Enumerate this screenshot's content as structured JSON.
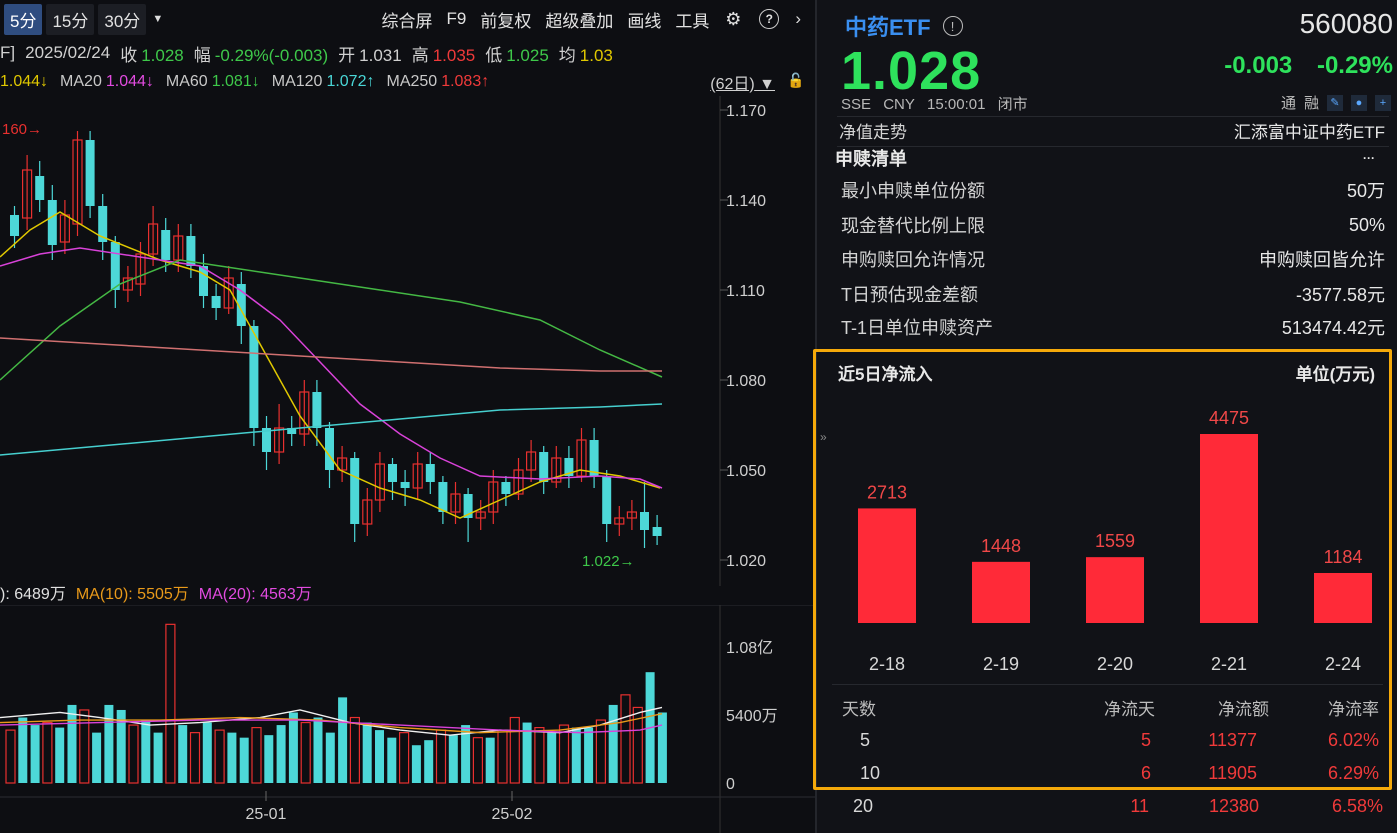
{
  "toolbar": {
    "periods": [
      "5分",
      "15分",
      "30分"
    ],
    "dropdown": "▼",
    "tools": [
      "综合屏",
      "F9",
      "前复权",
      "超级叠加",
      "画线",
      "工具"
    ],
    "settings_icon": "gear-icon",
    "help": "?",
    "more": "›"
  },
  "info": {
    "prefix": "F]",
    "date": "2025/02/24",
    "close_label": "收",
    "close": "1.028",
    "amp_label": "幅",
    "amp": "-0.29%(-0.003)",
    "open_label": "开",
    "open": "1.031",
    "high_label": "高",
    "high": "1.035",
    "low_label": "低",
    "low": "1.025",
    "avg_label": "均",
    "avg": "1.03"
  },
  "ma": {
    "ma10": "1.044↓",
    "ma20_label": "MA20",
    "ma20": "1.044↓",
    "ma60_label": "MA60",
    "ma60": "1.081↓",
    "ma120_label": "MA120",
    "ma120": "1.072↑",
    "ma250_label": "MA250",
    "ma250": "1.083↑",
    "period": "(62日)"
  },
  "price_axis": [
    "1.170",
    "1.140",
    "1.110",
    "1.080",
    "1.050",
    "1.020"
  ],
  "annotations": {
    "high_mark": "160",
    "low_mark": "1.022"
  },
  "volume": {
    "vol": "): 6489万",
    "ma10": "MA(10): 5505万",
    "ma20": "MA(20): 4563万",
    "axis": [
      "1.08亿",
      "5400万",
      "0"
    ]
  },
  "x_axis": [
    "25-01",
    "25-02"
  ],
  "etf": {
    "name": "中药ETF",
    "code": "560080",
    "price": "1.028",
    "change": "-0.003",
    "change_pct": "-0.29%",
    "exchange": "SSE",
    "currency": "CNY",
    "time": "15:00:01",
    "status": "闭市",
    "tong": "通",
    "rong": "融"
  },
  "details": {
    "nav_label": "净值走势",
    "nav_value": "汇添富中证中药ETF",
    "redeem_title": "申赎清单",
    "redeem_more": "···",
    "rows": [
      {
        "k": "最小申赎单位份额",
        "v": "50万"
      },
      {
        "k": "现金替代比例上限",
        "v": "50%"
      },
      {
        "k": "申购赎回允许情况",
        "v": "申购赎回皆允许"
      },
      {
        "k": "T日预估现金差额",
        "v": "-3577.58元"
      },
      {
        "k": "T-1日单位申赎资产",
        "v": "513474.42元"
      }
    ]
  },
  "flow": {
    "title": "近5日净流入",
    "unit": "单位(万元)",
    "headers": [
      "天数",
      "净流天",
      "净流额",
      "净流率"
    ],
    "table": [
      {
        "days": "5",
        "flow_days": "5",
        "amount": "11377",
        "rate": "6.02%"
      },
      {
        "days": "10",
        "flow_days": "6",
        "amount": "11905",
        "rate": "6.29%"
      },
      {
        "days": "20",
        "flow_days": "11",
        "amount": "12380",
        "rate": "6.58%"
      }
    ]
  },
  "chart_data": {
    "type": "bar",
    "title": "近5日净流入",
    "ylabel": "单位(万元)",
    "categories": [
      "2-18",
      "2-19",
      "2-20",
      "2-21",
      "2-24"
    ],
    "values": [
      2713,
      1448,
      1559,
      4475,
      1184
    ],
    "ylim": [
      0,
      4475
    ],
    "color": "#ff2a38"
  },
  "colors": {
    "up": "#f03a3a",
    "down": "#3ec84a",
    "accent": "#3a8ff0",
    "highlight_box": "#f5a90a"
  }
}
